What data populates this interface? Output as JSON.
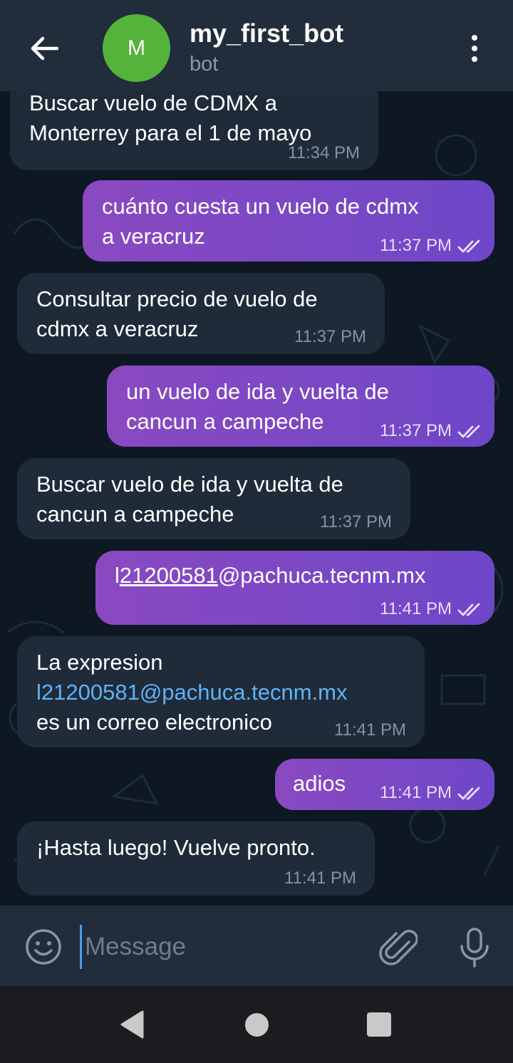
{
  "header": {
    "avatar_letter": "M",
    "title": "my_first_bot",
    "subtitle": "bot"
  },
  "messages": [
    {
      "side": "in",
      "text": "Buscar vuelo de CDMX a\nMonterrey para el 1 de mayo",
      "time": "11:34 PM"
    },
    {
      "side": "out",
      "text": "cuánto cuesta un vuelo de cdmx\na veracruz",
      "time": "11:37 PM"
    },
    {
      "side": "in",
      "text": "Consultar precio de vuelo de\ncdmx a veracruz",
      "time": "11:37 PM"
    },
    {
      "side": "out",
      "text": "un vuelo de ida y vuelta de\ncancun a campeche",
      "time": "11:37 PM"
    },
    {
      "side": "in",
      "text": "Buscar vuelo de ida y vuelta de\ncancun a campeche",
      "time": "11:37 PM"
    },
    {
      "side": "out",
      "text_prefix": "l",
      "text_link": "21200581",
      "text_suffix": "@pachuca.tecnm.mx",
      "time": "11:41 PM"
    },
    {
      "side": "in",
      "line1": "La expresion",
      "link": "l21200581@pachuca.tecnm.mx",
      "line3": "es un correo electronico",
      "time": "11:41 PM"
    },
    {
      "side": "out",
      "text": "adios",
      "time": "11:41 PM"
    },
    {
      "side": "in",
      "text": "¡Hasta luego! Vuelve pronto.",
      "time": "11:41 PM"
    }
  ],
  "input": {
    "placeholder": "Message"
  },
  "colors": {
    "header_bg": "#212d3b",
    "chat_bg": "#0e1822",
    "incoming_bubble": "#1f2b39",
    "outgoing_bubble_start": "#8a49c1",
    "outgoing_bubble_end": "#6e47c8",
    "avatar": "#55b33c",
    "link": "#5fb3f5"
  },
  "icons": [
    "arrow-back-icon",
    "more-vertical-icon",
    "double-check-icon",
    "emoji-icon",
    "paperclip-icon",
    "microphone-icon",
    "nav-back-icon",
    "nav-home-icon",
    "nav-recents-icon"
  ]
}
